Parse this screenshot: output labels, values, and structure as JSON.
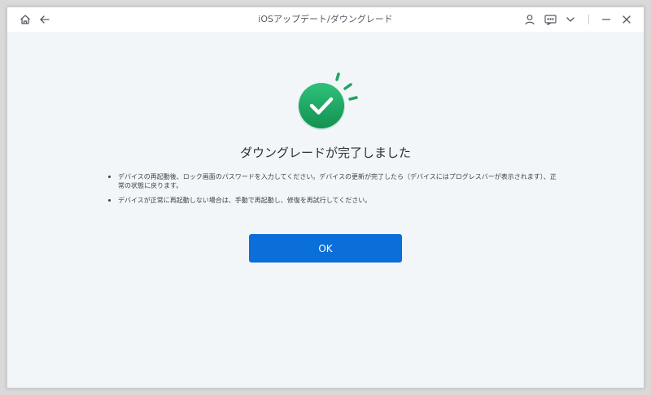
{
  "window": {
    "title": "iOSアップデート/ダウングレード"
  },
  "titlebar_icons": {
    "home": "home-icon",
    "back": "arrow-left-icon",
    "account": "user-icon",
    "feedback": "chat-icon",
    "menu": "chevron-down-icon",
    "minimize": "minimize-icon",
    "close": "close-icon"
  },
  "result": {
    "status_icon": "checkmark-circle-icon",
    "heading": "ダウングレードが完了しました",
    "notes": [
      "デバイスの再起動後、ロック画面のパスワードを入力してください。デバイスの更新が完了したら（デバイスにはプログレスバーが表示されます）、正常の状態に戻ります。",
      "デバイスが正常に再起動しない場合は、手動で再起動し、修復を再試行してください。"
    ],
    "ok_label": "OK"
  },
  "colors": {
    "accent": "#0a6fd8",
    "success": "#1fa463",
    "background": "#f2f6f9"
  }
}
